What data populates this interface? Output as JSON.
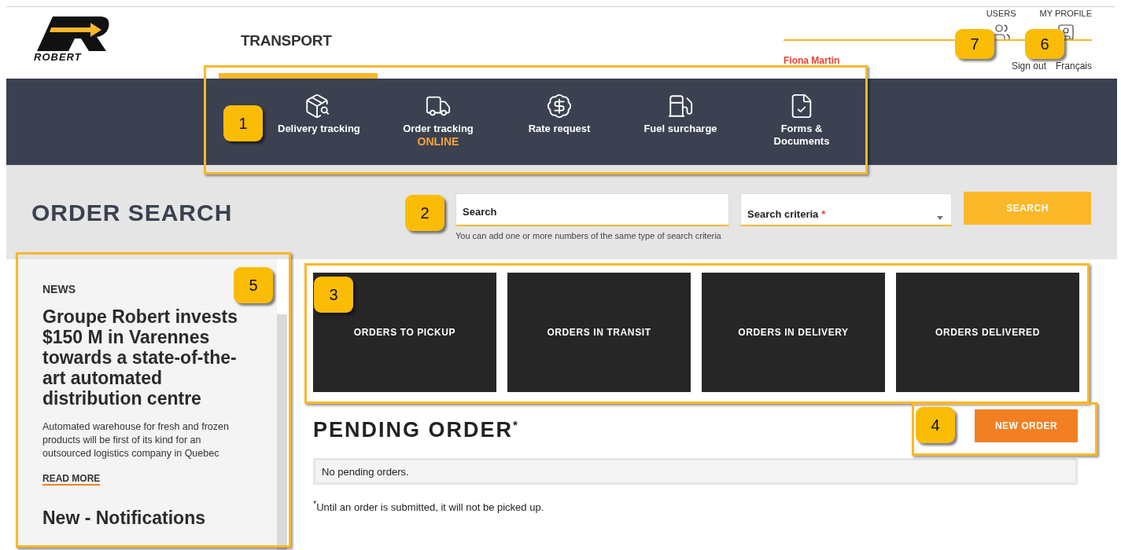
{
  "header": {
    "logo_text": "ROBERT",
    "section": "TRANSPORT",
    "links": [
      {
        "label": "USERS",
        "kind": "users"
      },
      {
        "label": "MY PROFILE",
        "kind": "profile"
      }
    ],
    "user_name": "Fiona Martin",
    "sign_out": "Sign out",
    "language": "Français"
  },
  "nav": [
    {
      "label": "Delivery tracking",
      "selected": true
    },
    {
      "label": "Order tracking",
      "subtitle": "ONLINE",
      "selected": false
    },
    {
      "label": "Rate request",
      "selected": false
    },
    {
      "label": "Fuel surcharge",
      "selected": false
    },
    {
      "label": "Forms & Documents",
      "selected": false
    }
  ],
  "order_search": {
    "title": "ORDER SEARCH",
    "search_placeholder": "Search",
    "hint": "You can add one or more numbers of the same type of search criteria",
    "criteria_placeholder": "Search criteria",
    "required_mark": "*",
    "button": "SEARCH"
  },
  "tiles": [
    "ORDERS TO PICKUP",
    "ORDERS IN TRANSIT",
    "ORDERS IN DELIVERY",
    "ORDERS DELIVERED"
  ],
  "pending": {
    "title": "PENDING ORDER",
    "title_mark": "*",
    "new_order": "NEW ORDER",
    "empty": "No pending orders.",
    "footnote": "$^{*}$Until an order is submitted, it will not be picked up."
  },
  "news": {
    "label": "NEWS",
    "headline": "Groupe Robert invests $150 M in Varennes towards a state-of-the-art automated distribution centre",
    "summary": "Automated warehouse for fresh and frozen products will be first of its kind for an outsourced logistics company in Quebec",
    "read_more": "READ MORE",
    "next_headline": "New - Notifications"
  },
  "callouts": [
    "1",
    "2",
    "3",
    "4",
    "5",
    "6",
    "7"
  ]
}
